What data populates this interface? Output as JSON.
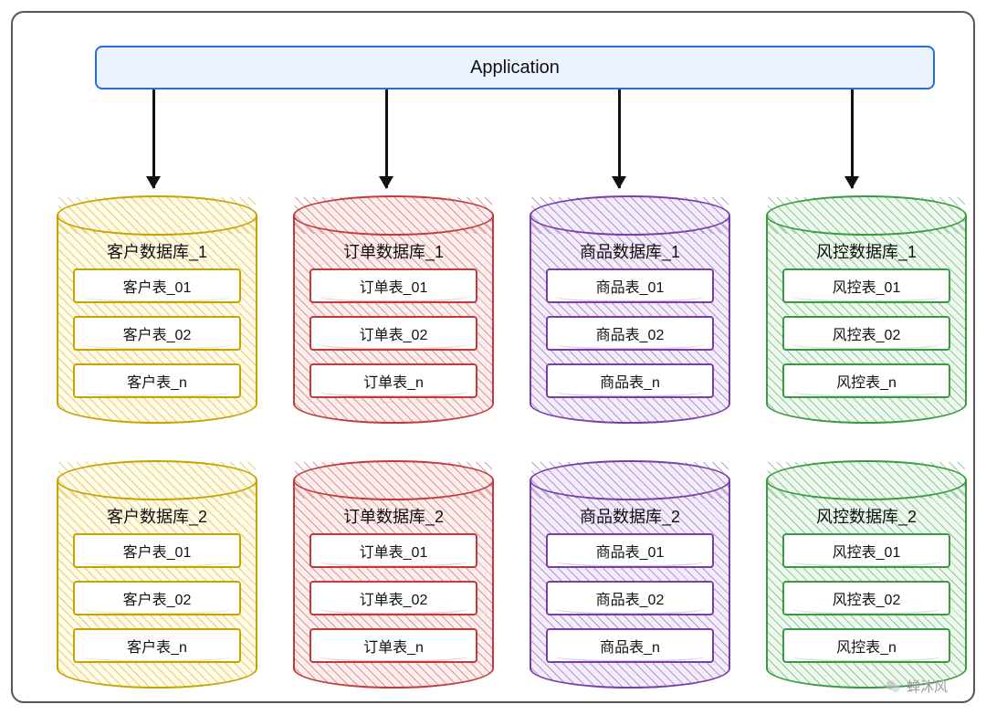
{
  "application_label": "Application",
  "columns": [
    {
      "color": "c-yellow",
      "name_prefix": "客户数据库",
      "table_prefix": "客户表"
    },
    {
      "color": "c-red",
      "name_prefix": "订单数据库",
      "table_prefix": "订单表"
    },
    {
      "color": "c-purple",
      "name_prefix": "商品数据库",
      "table_prefix": "商品表"
    },
    {
      "color": "c-green",
      "name_prefix": "风控数据库",
      "table_prefix": "风控表"
    }
  ],
  "db_index_suffixes": [
    "_1",
    "_2"
  ],
  "table_suffixes": [
    "_01",
    "_02",
    "_n"
  ],
  "databases": [
    {
      "label": "客户数据库_1",
      "color": "c-yellow",
      "tables": [
        "客户表_01",
        "客户表_02",
        "客户表_n"
      ]
    },
    {
      "label": "订单数据库_1",
      "color": "c-red",
      "tables": [
        "订单表_01",
        "订单表_02",
        "订单表_n"
      ]
    },
    {
      "label": "商品数据库_1",
      "color": "c-purple",
      "tables": [
        "商品表_01",
        "商品表_02",
        "商品表_n"
      ]
    },
    {
      "label": "风控数据库_1",
      "color": "c-green",
      "tables": [
        "风控表_01",
        "风控表_02",
        "风控表_n"
      ]
    },
    {
      "label": "客户数据库_2",
      "color": "c-yellow",
      "tables": [
        "客户表_01",
        "客户表_02",
        "客户表_n"
      ]
    },
    {
      "label": "订单数据库_2",
      "color": "c-red",
      "tables": [
        "订单表_01",
        "订单表_02",
        "订单表_n"
      ]
    },
    {
      "label": "商品数据库_2",
      "color": "c-purple",
      "tables": [
        "商品表_01",
        "商品表_02",
        "商品表_n"
      ]
    },
    {
      "label": "风控数据库_2",
      "color": "c-green",
      "tables": [
        "风控表_01",
        "风控表_02",
        "风控表_n"
      ]
    }
  ],
  "arrow_x_positions": [
    165,
    420,
    675,
    930
  ],
  "watermark_text": "蝉沐风"
}
